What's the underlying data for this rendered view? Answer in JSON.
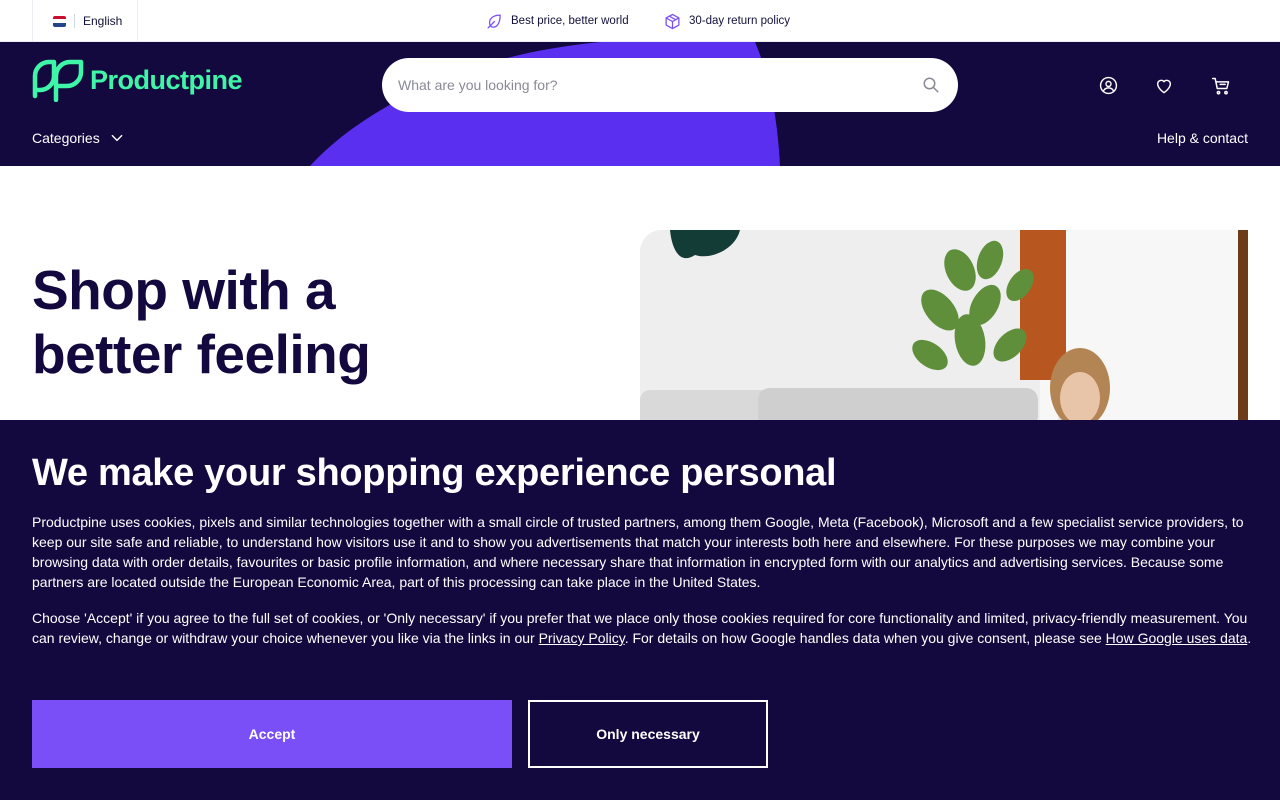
{
  "topbar": {
    "language": "English",
    "usp_price": "Best price, better world",
    "usp_return": "30-day return policy",
    "icons": {
      "price": "leaf-icon",
      "return": "box-icon"
    }
  },
  "header": {
    "brand": "Productpine",
    "search_placeholder": "What are you looking for?",
    "categories_label": "Categories",
    "help_label": "Help & contact",
    "icons": {
      "account": "user-icon",
      "favourites": "heart-icon",
      "cart": "cart-icon",
      "search": "search-icon"
    }
  },
  "hero": {
    "title": "Shop with a better feeling"
  },
  "cookie": {
    "title": "We make your shopping experience personal",
    "paragraph1": "Productpine uses cookies, pixels and similar technologies together with a small circle of trusted partners, among them Google, Meta (Facebook), Microsoft and a few specialist service providers, to keep our site safe and reliable, to understand how visitors use it and to show you advertisements that match your interests both here and elsewhere. For these purposes we may combine your browsing data with order details, favourites or basic profile information, and where necessary share that information in encrypted form with our analytics and advertising services. Because some partners are located outside the European Economic Area, part of this processing can take place in the United States.",
    "paragraph2_before": "Choose 'Accept' if you agree to the full set of cookies, or 'Only necessary' if you prefer that we place only those cookies required for core functionality and limited, privacy-friendly measurement. You can review, change or withdraw your choice whenever you like via the links in our ",
    "privacy_link": "Privacy Policy",
    "paragraph2_middle": ". For details on how Google handles data when you give consent, please see ",
    "google_link": "How Google uses data",
    "paragraph2_end": ".",
    "accept_label": "Accept",
    "necessary_label": "Only necessary"
  },
  "colors": {
    "navy": "#13093e",
    "brand_green": "#3ff5a8",
    "purple_accent": "#7b4ff7",
    "blob_purple": "#5a2ff0"
  }
}
